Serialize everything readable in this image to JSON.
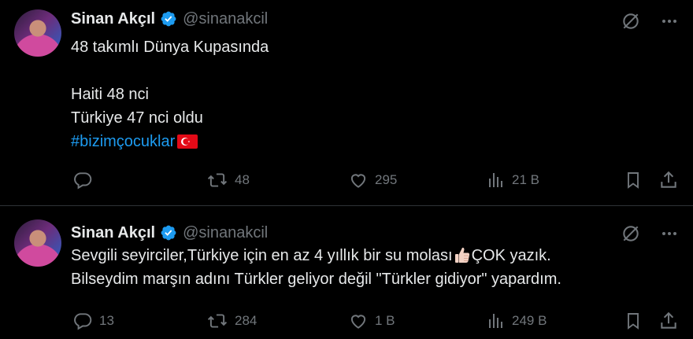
{
  "colors": {
    "background": "#000000",
    "text": "#e7e9ea",
    "muted": "#71767b",
    "accent": "#1d9bf0",
    "divider": "#2f3336"
  },
  "tweets": [
    {
      "author": {
        "name": "Sinan Akçıl",
        "handle": "@sinanakcil",
        "verified": true
      },
      "lines": [
        "48 takımlı Dünya Kupasında",
        "",
        "Haiti 48 nci",
        "Türkiye 47 nci oldu"
      ],
      "hashtag": "#bizimçocuklar",
      "hashtag_emoji": "turkey-flag",
      "stats": {
        "replies": "",
        "retweets": "48",
        "likes": "295",
        "views": "21 B"
      }
    },
    {
      "author": {
        "name": "Sinan Akçıl",
        "handle": "@sinanakcil",
        "verified": true
      },
      "line1_before": "Sevgili seyirciler,Türkiye için en az 4 yıllık bir su molası",
      "line1_emoji": "thumbs-up",
      "line1_after": "ÇOK yazık.",
      "line2": "Bilseydim marşın adını Türkler geliyor değil \"Türkler gidiyor\" yapardım.",
      "stats": {
        "replies": "13",
        "retweets": "284",
        "likes": "1 B",
        "views": "249 B"
      }
    }
  ]
}
